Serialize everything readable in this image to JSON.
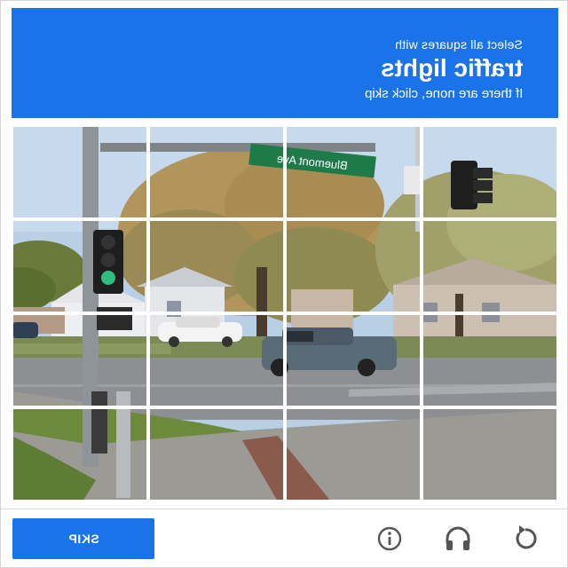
{
  "header": {
    "line1": "Select all squares with",
    "line2": "traffic lights",
    "line3": "If there are none, click skip"
  },
  "grid": {
    "rows": 4,
    "columns": 4,
    "street_sign": "Bluemont Ave"
  },
  "footer": {
    "skip_label": "SKIP",
    "icons": [
      "info-icon",
      "headphones-icon",
      "reload-icon"
    ]
  },
  "colors": {
    "accent": "#1a73e8",
    "icon": "#555555"
  }
}
